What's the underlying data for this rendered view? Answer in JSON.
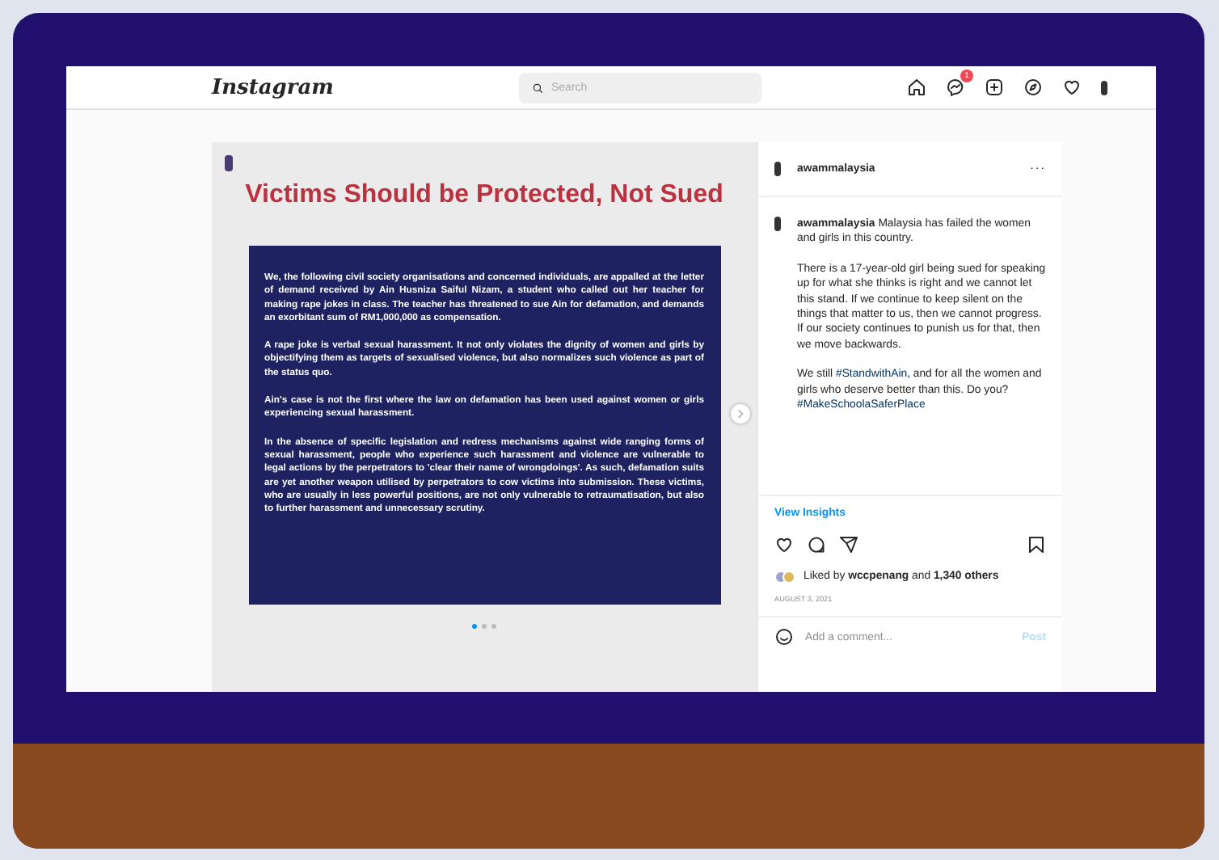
{
  "header": {
    "logo": "Instagram",
    "search": {
      "placeholder": "Search"
    },
    "nav": [
      {
        "kind": "home"
      },
      {
        "kind": "messenger",
        "badge": "1"
      },
      {
        "kind": "add"
      },
      {
        "kind": "explore"
      },
      {
        "kind": "heart"
      },
      {
        "kind": "avatar"
      }
    ]
  },
  "post_image": {
    "title": "Victims Should be Protected, Not Sued",
    "paragraphs": [
      "We, the following civil society organisations and concerned individuals, are appalled at the letter of demand received by Ain Husniza Saiful Nizam, a student who called out her teacher for making rape jokes in class. The teacher has threatened to sue Ain for defamation, and demands an exorbitant sum of RM1,000,000 as compensation.",
      "A rape joke is verbal sexual harassment. It not only violates the dignity of women and girls by objectifying them as targets of sexualised violence, but also normalizes such violence as part of the status quo.",
      "Ain's case is not the first where the law on defamation has been used against women or girls experiencing sexual harassment.",
      "In the absence of specific legislation and redress mechanisms against wide ranging forms of sexual harassment, people who experience such harassment and violence are vulnerable to legal actions by the perpetrators to 'clear their name of wrongdoings'. As such, defamation suits are yet another weapon utilised by perpetrators to cow victims into submission. These victims, who are usually in less powerful positions, are not only vulnerable to retraumatisation, but also to further harassment and unnecessary scrutiny."
    ],
    "dots": [
      {
        "selected": true
      },
      {
        "selected": false
      },
      {
        "selected": false
      }
    ]
  },
  "sidebar": {
    "username": "awammalaysia",
    "more": "···",
    "caption": [
      [
        {
          "kind": "text",
          "text": "**awammalaysia** Malaysia has failed the women and girls in this country."
        }
      ],
      [
        {
          "kind": "text",
          "text": "There is a 17-year-old girl being sued for speaking up for what she thinks is right and we cannot let this stand. If we continue to keep silent on the things that matter to us, then we cannot progress. If our society continues to punish us for that, then we move backwards."
        }
      ],
      [
        {
          "kind": "text",
          "text": "We still "
        },
        {
          "kind": "hashtag",
          "text": "#StandwithAin"
        },
        {
          "kind": "text",
          "text": ", and for all the women and girls who deserve better than this. Do you? "
        },
        {
          "kind": "hashtag",
          "text": "#MakeSchoolaSaferPlace"
        }
      ]
    ],
    "insights": "View Insights",
    "likes": "Liked by **wccpenang** and **1,340 others**",
    "date": "AUGUST 3, 2021",
    "comment": {
      "placeholder": "Add a comment..."
    },
    "post_button": "Post"
  }
}
